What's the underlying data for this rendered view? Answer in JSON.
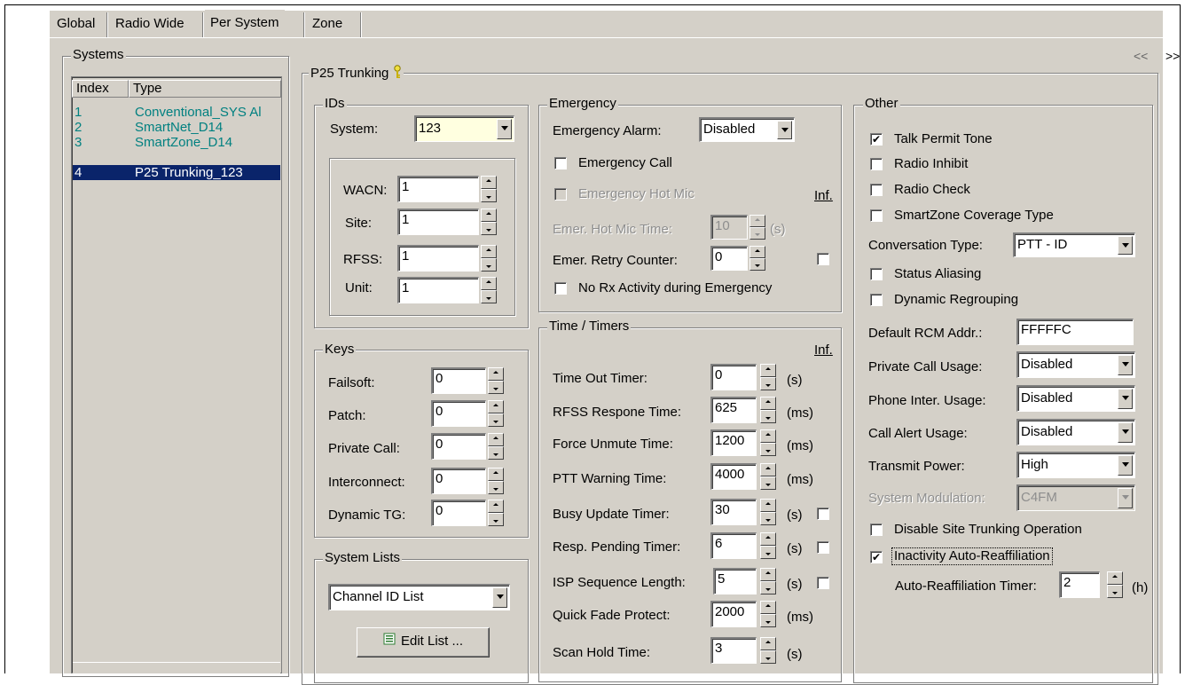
{
  "tabs": [
    "Global",
    "Radio Wide",
    "Per System",
    "Zone"
  ],
  "nav": {
    "prev": "<<",
    "next": ">>"
  },
  "systems": {
    "title": "Systems",
    "columns": [
      "Index",
      "Type"
    ],
    "rows": [
      {
        "index": "1",
        "type": "Conventional_SYS Al"
      },
      {
        "index": "2",
        "type": "SmartNet_D14"
      },
      {
        "index": "3",
        "type": "SmartZone_D14"
      },
      {
        "index": "4",
        "type": "P25 Trunking_123",
        "selected": true
      }
    ]
  },
  "p25": {
    "title": "P25 Trunking",
    "icon": "key-icon"
  },
  "ids": {
    "title": "IDs",
    "system_label": "System:",
    "system_value": "123",
    "wacn_label": "WACN:",
    "wacn_value": "1",
    "site_label": "Site:",
    "site_value": "1",
    "rfss_label": "RFSS:",
    "rfss_value": "1",
    "unit_label": "Unit:",
    "unit_value": "1"
  },
  "keys": {
    "title": "Keys",
    "failsoft_label": "Failsoft:",
    "failsoft_value": "0",
    "patch_label": "Patch:",
    "patch_value": "0",
    "private_label": "Private Call:",
    "private_value": "0",
    "interconnect_label": "Interconnect:",
    "interconnect_value": "0",
    "dynamic_label": "Dynamic TG:",
    "dynamic_value": "0"
  },
  "system_lists": {
    "title": "System Lists",
    "selected": "Channel ID List",
    "edit_label": "Edit List ..."
  },
  "emergency": {
    "title": "Emergency",
    "alarm_label": "Emergency Alarm:",
    "alarm_value": "Disabled",
    "call_label": "Emergency Call",
    "hotmic_label": "Emergency Hot Mic",
    "inf_label": "Inf.",
    "hotmic_time_label": "Emer. Hot Mic Time:",
    "hotmic_time_value": "10",
    "hotmic_time_unit": "(s)",
    "retry_label": "Emer. Retry Counter:",
    "retry_value": "0",
    "norx_label": "No Rx Activity during Emergency"
  },
  "timers": {
    "title": "Time / Timers",
    "inf_label": "Inf.",
    "rows": [
      {
        "label": "Time Out Timer:",
        "value": "0",
        "unit": "(s)"
      },
      {
        "label": "RFSS Respone Time:",
        "value": "625",
        "unit": "(ms)"
      },
      {
        "label": "Force Unmute Time:",
        "value": "1200",
        "unit": "(ms)"
      },
      {
        "label": "PTT Warning Time:",
        "value": "4000",
        "unit": "(ms)"
      },
      {
        "label": "Busy Update Timer:",
        "value": "30",
        "unit": "(s)"
      },
      {
        "label": "Resp. Pending Timer:",
        "value": "6",
        "unit": "(s)"
      },
      {
        "label": "ISP Sequence Length:",
        "value": "5",
        "unit": "(s)"
      },
      {
        "label": "Quick Fade Protect:",
        "value": "2000",
        "unit": "(ms)"
      },
      {
        "label": "Scan Hold Time:",
        "value": "3",
        "unit": "(s)"
      }
    ]
  },
  "other": {
    "title": "Other",
    "talk_permit": "Talk Permit Tone",
    "radio_inhibit": "Radio Inhibit",
    "radio_check": "Radio Check",
    "smartzone_cov": "SmartZone Coverage Type",
    "conv_type_label": "Conversation Type:",
    "conv_type_value": "PTT - ID",
    "status_aliasing": "Status Aliasing",
    "dynamic_regroup": "Dynamic Regrouping",
    "rcm_label": "Default RCM Addr.:",
    "rcm_value": "FFFFFC",
    "private_usage_label": "Private Call Usage:",
    "private_usage_value": "Disabled",
    "phone_usage_label": "Phone Inter. Usage:",
    "phone_usage_value": "Disabled",
    "alert_usage_label": "Call Alert Usage:",
    "alert_usage_value": "Disabled",
    "power_label": "Transmit Power:",
    "power_value": "High",
    "modulation_label": "System Modulation:",
    "modulation_value": "C4FM",
    "disable_site": "Disable Site Trunking Operation",
    "inactivity": "Inactivity Auto-Reaffiliation",
    "reaff_timer_label": "Auto-Reaffiliation Timer:",
    "reaff_timer_value": "2",
    "reaff_timer_unit": "(h)"
  }
}
